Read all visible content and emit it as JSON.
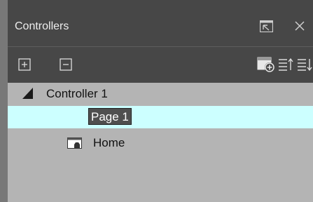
{
  "window": {
    "title": "Controllers",
    "header_buttons": [
      {
        "name": "popout",
        "icon": "popout-icon"
      },
      {
        "name": "close",
        "icon": "close-icon"
      }
    ]
  },
  "toolbar": {
    "left": [
      {
        "name": "expand-all",
        "icon": "plus-box-icon"
      },
      {
        "name": "collapse-all",
        "icon": "minus-box-icon"
      }
    ],
    "right": [
      {
        "name": "add-page",
        "icon": "add-page-icon"
      },
      {
        "name": "move-up",
        "icon": "list-up-icon"
      },
      {
        "name": "move-down",
        "icon": "list-down-icon"
      }
    ]
  },
  "tree": {
    "controller": {
      "label": "Controller 1",
      "icon": "expanded-triangle-icon"
    },
    "editing_item": {
      "value": "Page 1",
      "selected": true
    },
    "items": [
      {
        "label": "Home",
        "icon": "page-icon"
      }
    ]
  },
  "colors": {
    "header_bg": "#474747",
    "panel_bg": "#b4b4b4",
    "selection_bg": "#ccffff",
    "edit_bg": "#4f4f4f",
    "left_strip": "#787878"
  }
}
